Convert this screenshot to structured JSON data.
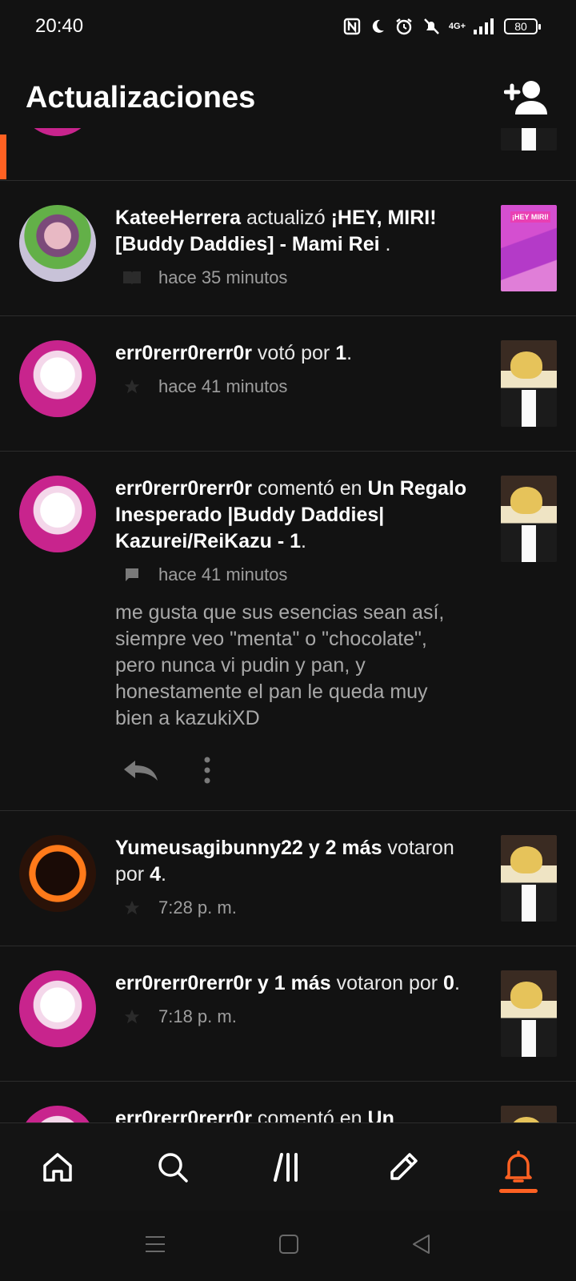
{
  "status_bar": {
    "time": "20:40",
    "network": "4G+",
    "battery": "80"
  },
  "header": {
    "title": "Actualizaciones",
    "add_friend_icon": "add-person-icon"
  },
  "colors": {
    "accent": "#ff6122",
    "background": "#121212",
    "divider": "#2c2c2c",
    "muted_text": "#9e9e9e"
  },
  "feed": [
    {
      "partial": true
    },
    {
      "user": "KateeHerrera",
      "verb": " actualizó ",
      "target": "¡HEY, MIRI! [Buddy Daddies] - Mami Rei",
      "suffix": " .",
      "icon": "book-icon",
      "time": "hace 35 minutos"
    },
    {
      "user": "err0rerr0rerr0r",
      "verb": " votó por ",
      "target": "1",
      "suffix": ".",
      "icon": "star-icon",
      "time": "hace 41 minutos"
    },
    {
      "user": "err0rerr0rerr0r",
      "verb": " comentó en ",
      "target": "Un Regalo Inesperado |Buddy Daddies| Kazurei/ReiKazu - 1",
      "suffix": ".",
      "icon": "comment-icon",
      "time": "hace 41 minutos",
      "comment": "me gusta que sus esencias sean así, siempre veo \"menta\" o \"chocolate\", pero nunca vi pudin y pan, y honestamente el pan le queda muy bien a kazukiXD"
    },
    {
      "user": "Yumeusagibunny22 y 2 más",
      "verb": " votaron por ",
      "target": "4",
      "suffix": ".",
      "icon": "star-icon",
      "time": "7:28 p. m."
    },
    {
      "user": "err0rerr0rerr0r y 1 más",
      "verb": " votaron por ",
      "target": "0",
      "suffix": ".",
      "icon": "star-icon",
      "time": "7:18 p. m."
    },
    {
      "user": "err0rerr0rerr0r",
      "verb": " comentó en ",
      "target": "Un",
      "suffix": ""
    }
  ],
  "bottom_nav": [
    {
      "icon": "home-icon",
      "active": false
    },
    {
      "icon": "search-icon",
      "active": false
    },
    {
      "icon": "library-icon",
      "active": false
    },
    {
      "icon": "write-icon",
      "active": false
    },
    {
      "icon": "notifications-icon",
      "active": true
    }
  ]
}
